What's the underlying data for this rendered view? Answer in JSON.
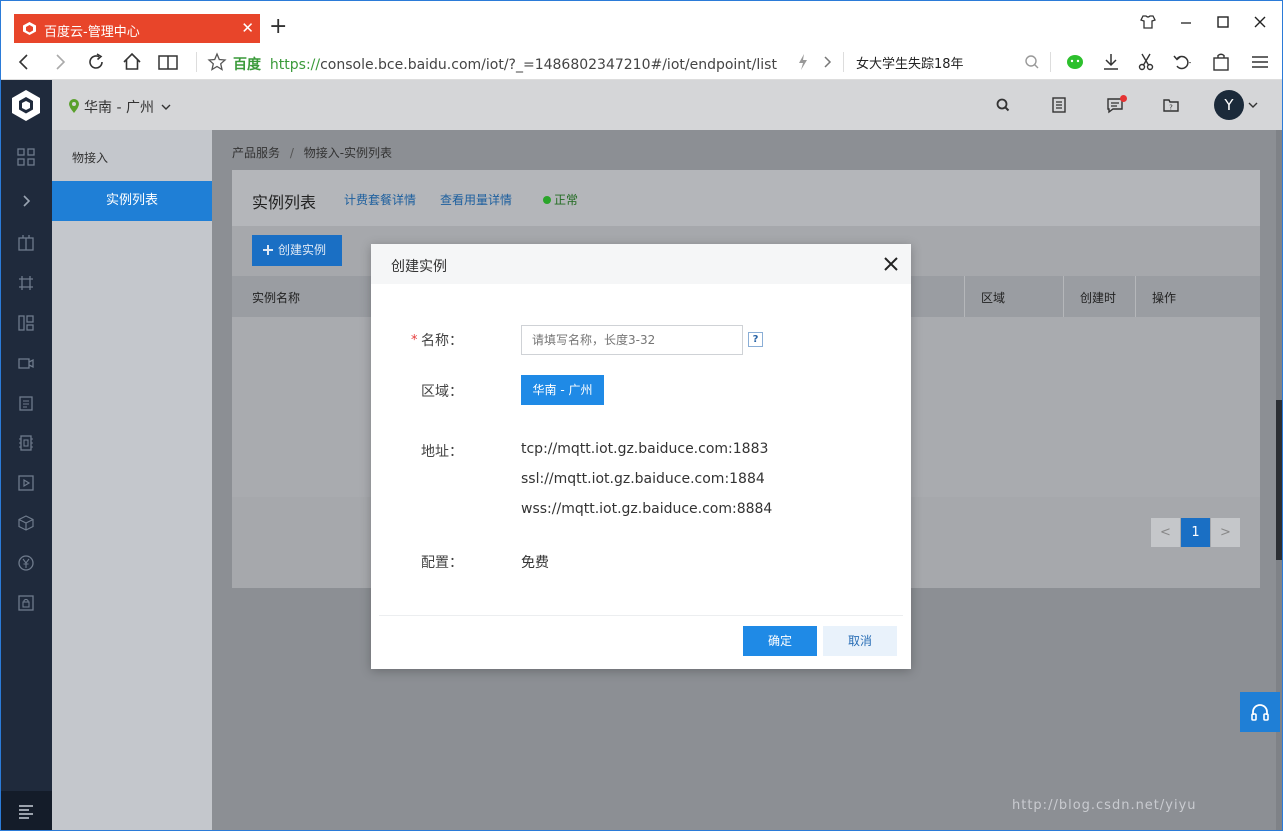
{
  "browser": {
    "tab_title": "百度云-管理中心",
    "url_prefix_label": "百度",
    "url_protocol": "https://",
    "url_rest": "console.bce.baidu.com/iot/?_=1486802347210#/iot/endpoint/list",
    "search_text": "女大学生失踪18年",
    "accent": "#e8452a"
  },
  "console": {
    "region": "华南 - 广州",
    "avatar_letter": "Y",
    "nav_color": "#1f2a3c",
    "primary": "#1f8ae6"
  },
  "subnav": {
    "title": "物接入",
    "active_item": "实例列表"
  },
  "breadcrumb": {
    "items": [
      "产品服务",
      "物接入-实例列表"
    ],
    "separator": "/"
  },
  "panel": {
    "title": "实例列表",
    "link_billing": "计费套餐详情",
    "link_usage": "查看用量详情",
    "status": "正常",
    "create_button": "创建实例",
    "columns": [
      "实例名称",
      "区域",
      "创建时",
      "操作"
    ],
    "pager": {
      "prev": "<",
      "current": "1",
      "next": ">"
    }
  },
  "modal": {
    "title": "创建实例",
    "name_label": "名称：",
    "required_mark": "*",
    "name_placeholder": "请填写名称，长度3-32",
    "help_mark": "?",
    "region_label": "区域：",
    "region_value": "华南 - 广州",
    "address_label": "地址：",
    "addresses": [
      "tcp://mqtt.iot.gz.baiduce.com:1883",
      "ssl://mqtt.iot.gz.baiduce.com:1884",
      "wss://mqtt.iot.gz.baiduce.com:8884"
    ],
    "config_label": "配置：",
    "config_value": "免费",
    "ok_button": "确定",
    "cancel_button": "取消"
  },
  "watermark": "http://blog.csdn.net/yiyu"
}
